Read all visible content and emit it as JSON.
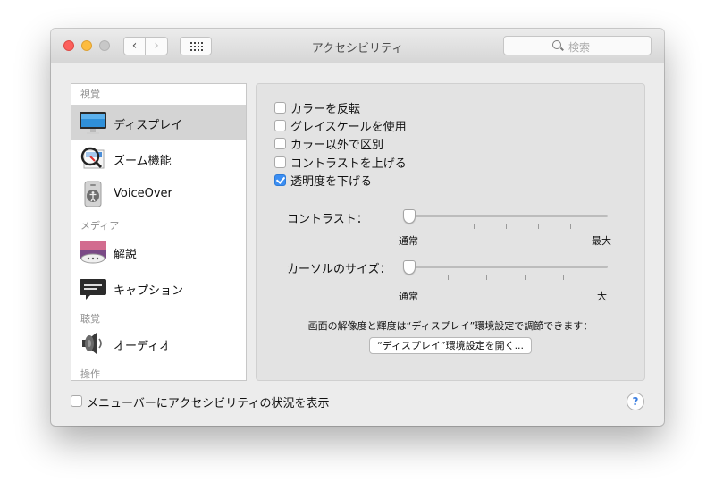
{
  "window": {
    "title": "アクセシビリティ",
    "search_placeholder": "検索"
  },
  "nav": {
    "back": "‹",
    "forward": "›"
  },
  "sidebar": {
    "sections": [
      {
        "label": "視覚"
      },
      {
        "label": "メディア"
      },
      {
        "label": "聴覚"
      },
      {
        "label": "操作"
      }
    ],
    "items": [
      {
        "label": "ディスプレイ",
        "icon": "display-icon",
        "selected": true
      },
      {
        "label": "ズーム機能",
        "icon": "zoom-icon",
        "selected": false
      },
      {
        "label": "VoiceOver",
        "icon": "voiceover-icon",
        "selected": false
      },
      {
        "label": "解説",
        "icon": "descriptions-icon",
        "selected": false
      },
      {
        "label": "キャプション",
        "icon": "captions-icon",
        "selected": false
      },
      {
        "label": "オーディオ",
        "icon": "audio-speaker-icon",
        "selected": false
      }
    ]
  },
  "display": {
    "options": [
      {
        "label": "カラーを反転",
        "checked": false
      },
      {
        "label": "グレイスケールを使用",
        "checked": false
      },
      {
        "label": "カラー以外で区別",
        "checked": false
      },
      {
        "label": "コントラストを上げる",
        "checked": false
      },
      {
        "label": "透明度を下げる",
        "checked": true
      }
    ],
    "contrast": {
      "label": "コントラスト：",
      "min_label": "通常",
      "max_label": "最大",
      "value": 0
    },
    "cursor": {
      "label": "カーソルのサイズ：",
      "min_label": "通常",
      "max_label": "大",
      "value": 0
    },
    "note": "画面の解像度と輝度は“ディスプレイ”環境設定で調節できます：",
    "open_button": "“ディスプレイ”環境設定を開く..."
  },
  "footer": {
    "menubar_checkbox": "メニューバーにアクセシビリティの状況を表示",
    "menubar_checked": false,
    "help": "?"
  },
  "colors": {
    "accent": "#3b8ef3",
    "close": "#fc605c",
    "minimize": "#fdbc40"
  }
}
